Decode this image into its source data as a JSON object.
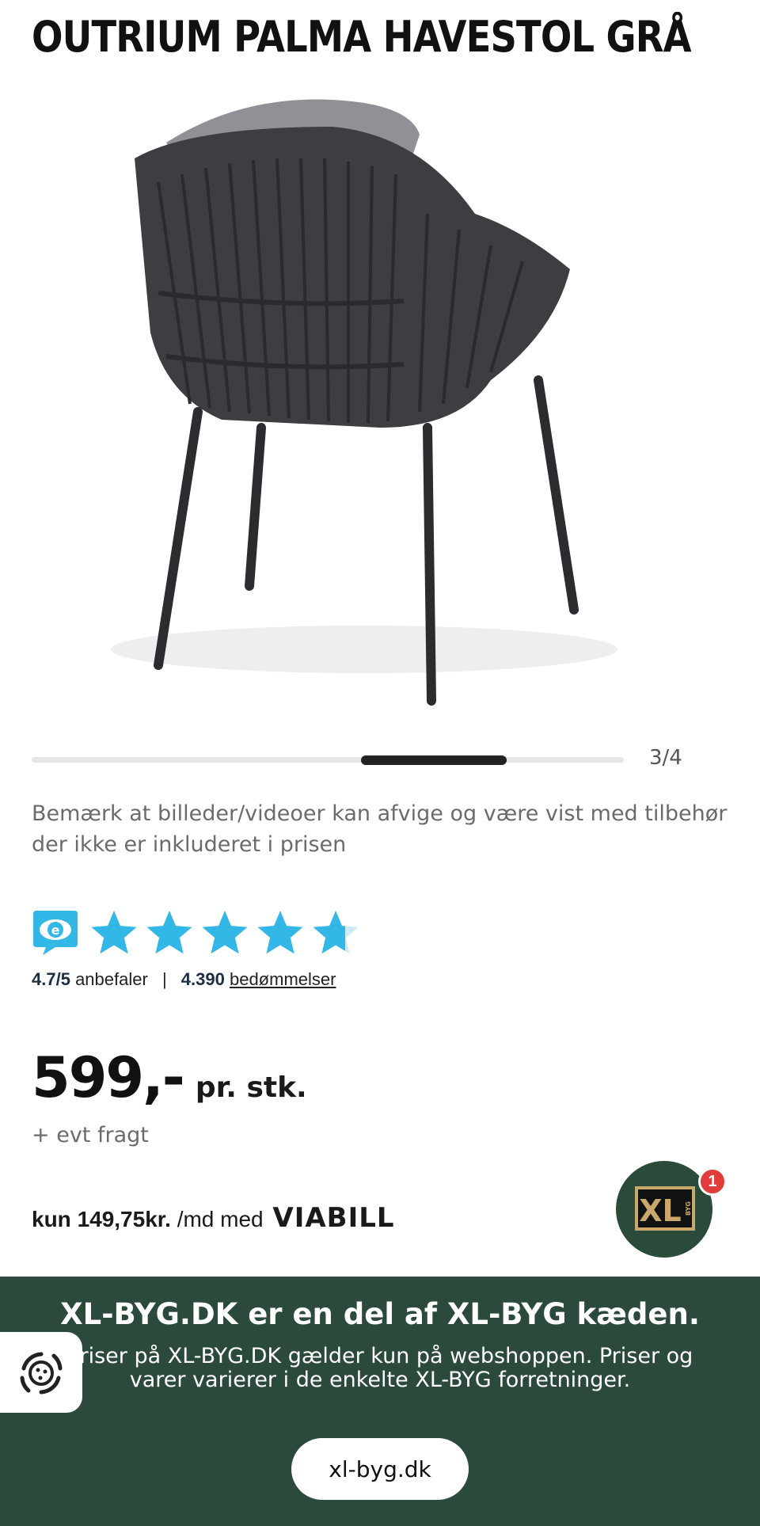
{
  "product": {
    "title": "OUTRIUM PALMA HAVESTOL GRÅ"
  },
  "gallery": {
    "counter": "3/4",
    "current": 3,
    "total": 4,
    "disclaimer": "Bemærk at billeder/videoer kan afvige og være vist med tilbehør der ikke er inkluderet i prisen"
  },
  "rating": {
    "score": "4.7/5",
    "recommend_label": "anbefaler",
    "separator": "|",
    "count": "4.390",
    "reviews_link": "bedømmelser",
    "stars_value": 4.7,
    "stars_max": 5,
    "star_color": "#33b7e6"
  },
  "price": {
    "amount": "599,-",
    "unit": "pr. stk.",
    "freight_note": "+ evt fragt"
  },
  "financing": {
    "prefix": "kun",
    "amount": "149,75kr.",
    "suffix": "/md med",
    "provider_logo": "VIABILL"
  },
  "chat_badge": {
    "logo_text": "XL",
    "logo_sub": "BYG",
    "notification_count": "1"
  },
  "footer": {
    "headline": "XL-BYG.DK er en del af XL-BYG kæden.",
    "subtext": "Priser på XL-BYG.DK gælder kun på webshoppen. Priser og varer varierer i de enkelte XL-BYG forretninger.",
    "site_button": "xl-byg.dk",
    "background_color": "#2c4a3b"
  },
  "icons": {
    "cookie": "cookie-settings-icon",
    "emaerket": "e-maerket-icon"
  }
}
